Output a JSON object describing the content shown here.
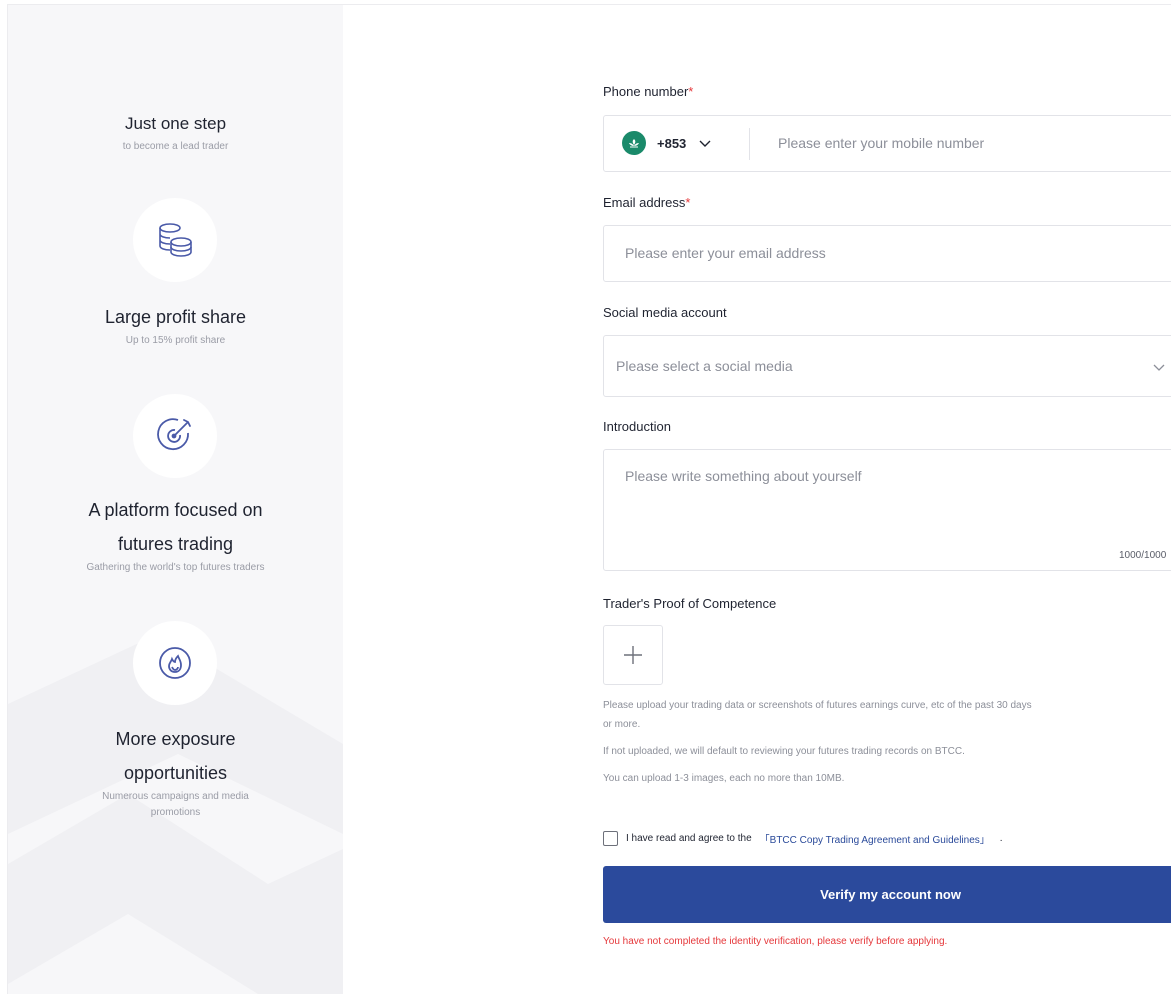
{
  "features": [
    {
      "icon": "target",
      "title": "Just one step",
      "subtitle": "to become a lead trader"
    },
    {
      "icon": "coins-icon",
      "title": "Large profit share",
      "subtitle": "Up to 15% profit share"
    },
    {
      "icon": "target-dart-icon",
      "title_line1": "A platform focused on",
      "title_line2": "futures trading",
      "subtitle": "Gathering the world's top futures traders"
    },
    {
      "icon": "fire-icon",
      "title_line1": "More exposure",
      "title_line2": "opportunities",
      "subtitle_line1": "Numerous campaigns and media",
      "subtitle_line2": "promotions"
    }
  ],
  "form": {
    "phone": {
      "label": "Phone number",
      "required": "*",
      "country_code": "+853",
      "placeholder": "Please enter your mobile number"
    },
    "email": {
      "label": "Email address",
      "required": "*",
      "placeholder": "Please enter your email address"
    },
    "social": {
      "label": "Social media account",
      "placeholder": "Please select a social media"
    },
    "intro": {
      "label": "Introduction",
      "placeholder": "Please write something about yourself",
      "counter": "1000/1000"
    },
    "proof": {
      "label": "Trader's Proof of Competence",
      "notes": [
        "Please upload your trading data or screenshots of futures earnings curve, etc of the past 30 days",
        "or more.",
        "If not uploaded, we will default to reviewing your futures trading records on BTCC.",
        "You can upload 1-3 images, each no more than 10MB."
      ]
    },
    "agreement": {
      "text": "I have read and agree to the",
      "link": "「BTCC Copy Trading Agreement and Guidelines」",
      "suffix": "."
    },
    "submit_label": "Verify my account now",
    "warning": "You have not completed the identity verification, please verify before applying."
  },
  "colors": {
    "accent": "#2b4a9c",
    "error": "#e5383b",
    "icon": "#4a5aa8"
  }
}
